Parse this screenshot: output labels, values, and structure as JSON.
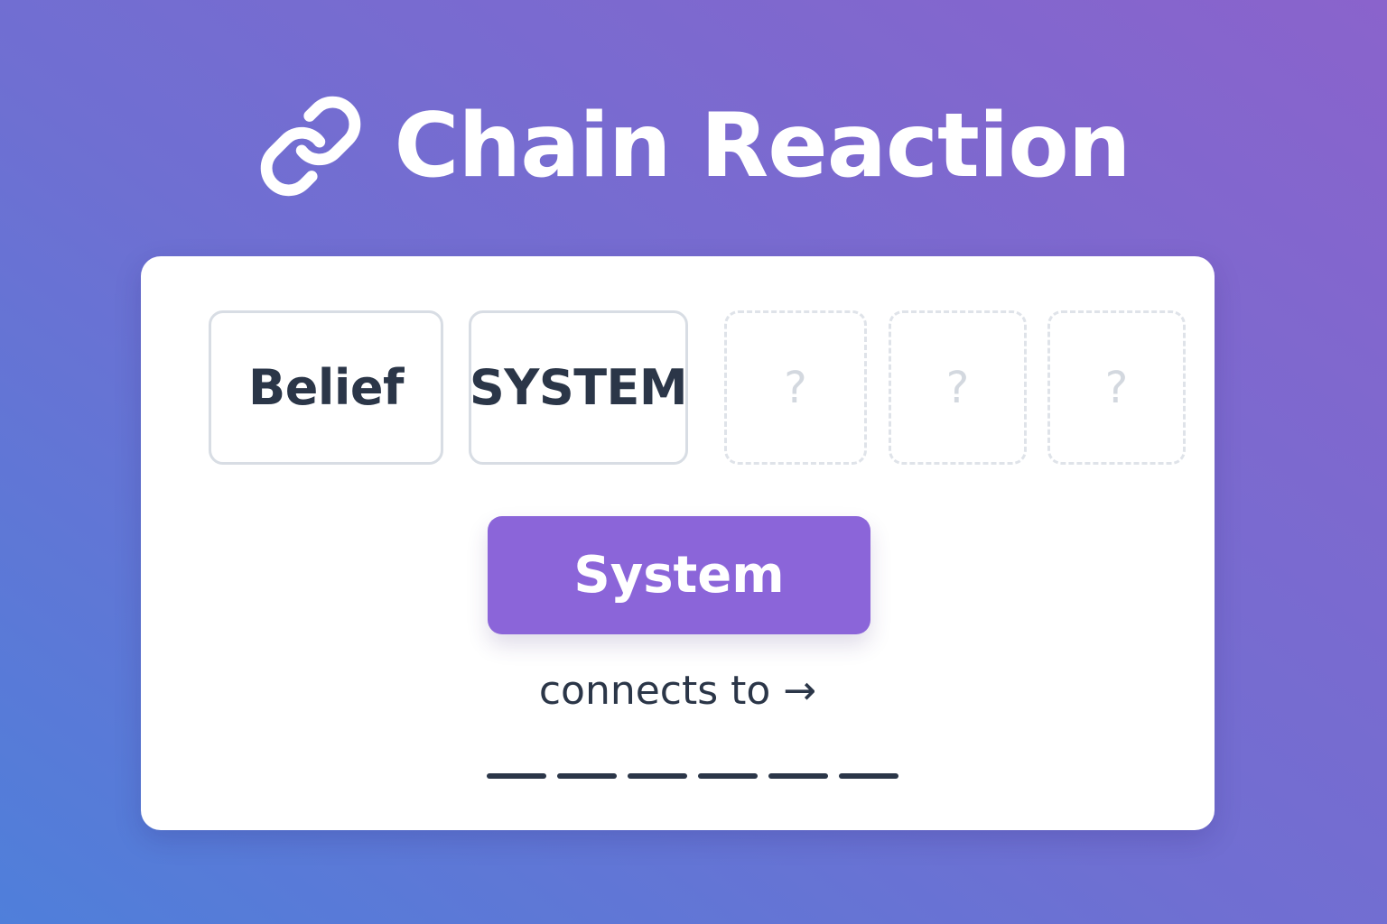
{
  "header": {
    "icon": "link-icon",
    "title": "Chain Reaction"
  },
  "chain": {
    "tiles": [
      {
        "word": "Belief",
        "state": "revealed"
      },
      {
        "word": "SYSTEM",
        "state": "revealed"
      },
      {
        "word": "?",
        "state": "hidden"
      },
      {
        "word": "?",
        "state": "hidden"
      },
      {
        "word": "?",
        "state": "hidden"
      }
    ]
  },
  "current": {
    "word": "System",
    "connects_label": "connects to →",
    "answer_blank_count": 6
  },
  "colors": {
    "accent": "#8b65d9",
    "text": "#2b3648",
    "tile_border": "#d8dde4",
    "placeholder": "#d3d8df",
    "background_start": "#4f7fda",
    "background_end": "#8a63cc"
  }
}
